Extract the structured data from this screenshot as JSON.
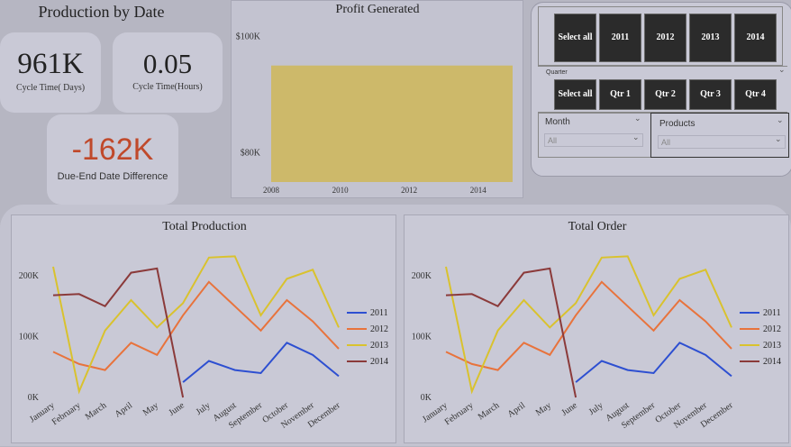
{
  "header": {
    "title": "Production by Date"
  },
  "kpis": [
    {
      "value": "961K",
      "label": "Cycle Time( Days)"
    },
    {
      "value": "0.05",
      "label": "Cycle Time(Hours)"
    },
    {
      "value": "-162K",
      "label": "Due-End Date Difference"
    }
  ],
  "colors": {
    "accent_red": "#c0492b",
    "bar": "#cdb96a",
    "s2011": "#2d4fd1",
    "s2012": "#e8733c",
    "s2013": "#d9c22e",
    "s2014": "#8b3a3a"
  },
  "slicers": {
    "years": [
      "Select all",
      "2011",
      "2012",
      "2013",
      "2014"
    ],
    "quarter_label": "Quarter",
    "quarters": [
      "Select all",
      "Qtr 1",
      "Qtr 2",
      "Qtr 3",
      "Qtr 4"
    ],
    "month": {
      "label": "Month",
      "value": "All"
    },
    "products": {
      "label": "Products",
      "value": "All"
    }
  },
  "chart_data": [
    {
      "type": "bar",
      "title": "Profit Generated",
      "categories": [
        "2008–2015"
      ],
      "values": [
        95000
      ],
      "x_ticks": [
        "2008",
        "2010",
        "2012",
        "2014"
      ],
      "y_ticks": [
        "$80K",
        "$100K"
      ],
      "ylim": [
        75000,
        103000
      ],
      "xlim": [
        2008,
        2015
      ],
      "bar_range": [
        2008,
        2015
      ]
    },
    {
      "type": "line",
      "title": "Total Production",
      "categories": [
        "January",
        "February",
        "March",
        "April",
        "May",
        "June",
        "July",
        "August",
        "September",
        "October",
        "November",
        "December"
      ],
      "y_ticks": [
        "0K",
        "100K",
        "200K"
      ],
      "ylim": [
        0,
        240000
      ],
      "legend": "right",
      "series": [
        {
          "name": "2011",
          "values": [
            null,
            null,
            null,
            null,
            null,
            25000,
            60000,
            45000,
            40000,
            90000,
            70000,
            35000
          ]
        },
        {
          "name": "2012",
          "values": [
            75000,
            55000,
            45000,
            90000,
            70000,
            135000,
            190000,
            150000,
            110000,
            160000,
            125000,
            80000
          ]
        },
        {
          "name": "2013",
          "values": [
            215000,
            10000,
            110000,
            160000,
            115000,
            155000,
            230000,
            232000,
            135000,
            195000,
            210000,
            115000
          ]
        },
        {
          "name": "2014",
          "values": [
            168000,
            170000,
            150000,
            205000,
            212000,
            0,
            null,
            null,
            null,
            null,
            null,
            null
          ]
        }
      ]
    },
    {
      "type": "line",
      "title": "Total Order",
      "categories": [
        "January",
        "February",
        "March",
        "April",
        "May",
        "June",
        "July",
        "August",
        "September",
        "October",
        "November",
        "December"
      ],
      "y_ticks": [
        "0K",
        "100K",
        "200K"
      ],
      "ylim": [
        0,
        240000
      ],
      "legend": "right",
      "series": [
        {
          "name": "2011",
          "values": [
            null,
            null,
            null,
            null,
            null,
            25000,
            60000,
            45000,
            40000,
            90000,
            70000,
            35000
          ]
        },
        {
          "name": "2012",
          "values": [
            75000,
            55000,
            45000,
            90000,
            70000,
            135000,
            190000,
            150000,
            110000,
            160000,
            125000,
            80000
          ]
        },
        {
          "name": "2013",
          "values": [
            215000,
            10000,
            110000,
            160000,
            115000,
            155000,
            230000,
            232000,
            135000,
            195000,
            210000,
            115000
          ]
        },
        {
          "name": "2014",
          "values": [
            168000,
            170000,
            150000,
            205000,
            212000,
            0,
            null,
            null,
            null,
            null,
            null,
            null
          ]
        }
      ]
    }
  ]
}
